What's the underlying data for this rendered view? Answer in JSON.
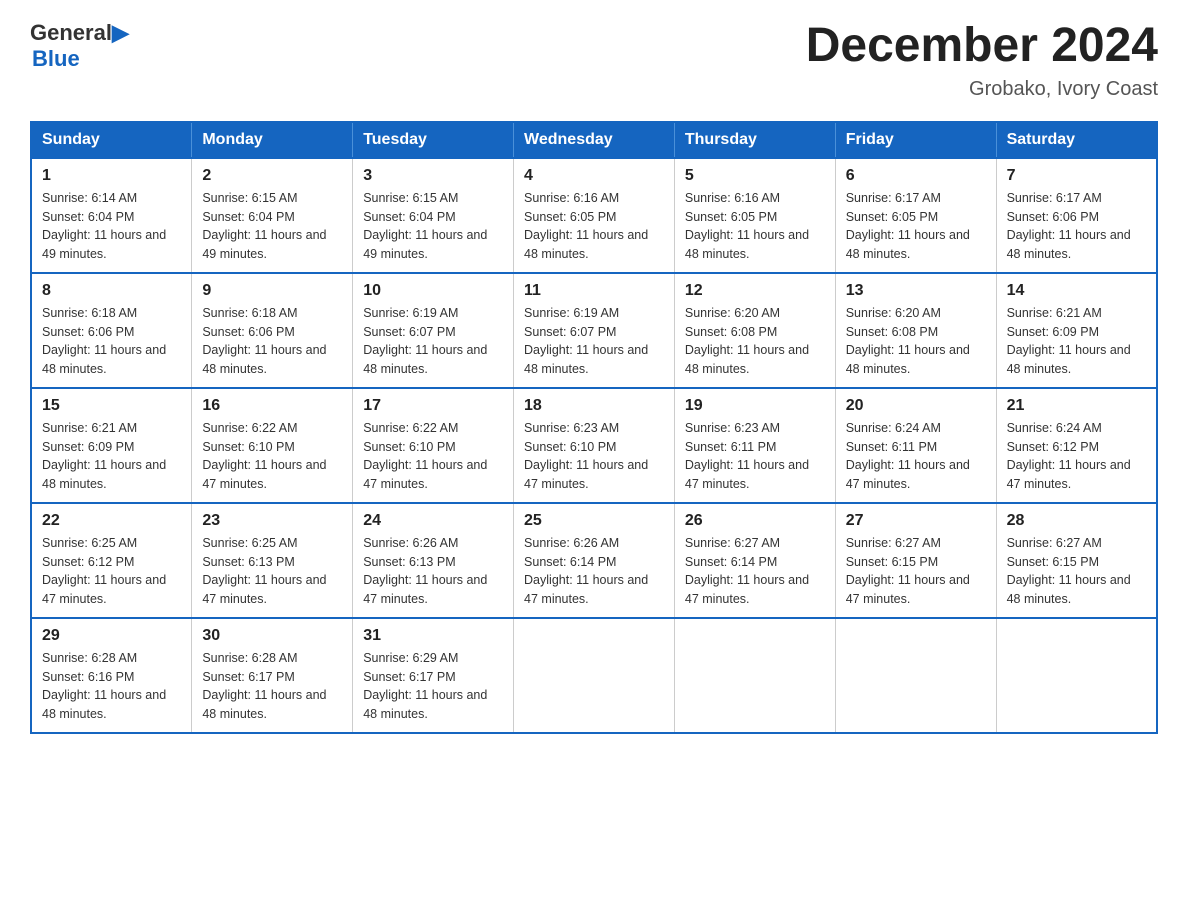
{
  "logo": {
    "general": "General",
    "blue": "Blue",
    "arrow": "▶"
  },
  "title": "December 2024",
  "subtitle": "Grobako, Ivory Coast",
  "days_of_week": [
    "Sunday",
    "Monday",
    "Tuesday",
    "Wednesday",
    "Thursday",
    "Friday",
    "Saturday"
  ],
  "weeks": [
    [
      {
        "day": "1",
        "sunrise": "6:14 AM",
        "sunset": "6:04 PM",
        "daylight": "11 hours and 49 minutes."
      },
      {
        "day": "2",
        "sunrise": "6:15 AM",
        "sunset": "6:04 PM",
        "daylight": "11 hours and 49 minutes."
      },
      {
        "day": "3",
        "sunrise": "6:15 AM",
        "sunset": "6:04 PM",
        "daylight": "11 hours and 49 minutes."
      },
      {
        "day": "4",
        "sunrise": "6:16 AM",
        "sunset": "6:05 PM",
        "daylight": "11 hours and 48 minutes."
      },
      {
        "day": "5",
        "sunrise": "6:16 AM",
        "sunset": "6:05 PM",
        "daylight": "11 hours and 48 minutes."
      },
      {
        "day": "6",
        "sunrise": "6:17 AM",
        "sunset": "6:05 PM",
        "daylight": "11 hours and 48 minutes."
      },
      {
        "day": "7",
        "sunrise": "6:17 AM",
        "sunset": "6:06 PM",
        "daylight": "11 hours and 48 minutes."
      }
    ],
    [
      {
        "day": "8",
        "sunrise": "6:18 AM",
        "sunset": "6:06 PM",
        "daylight": "11 hours and 48 minutes."
      },
      {
        "day": "9",
        "sunrise": "6:18 AM",
        "sunset": "6:06 PM",
        "daylight": "11 hours and 48 minutes."
      },
      {
        "day": "10",
        "sunrise": "6:19 AM",
        "sunset": "6:07 PM",
        "daylight": "11 hours and 48 minutes."
      },
      {
        "day": "11",
        "sunrise": "6:19 AM",
        "sunset": "6:07 PM",
        "daylight": "11 hours and 48 minutes."
      },
      {
        "day": "12",
        "sunrise": "6:20 AM",
        "sunset": "6:08 PM",
        "daylight": "11 hours and 48 minutes."
      },
      {
        "day": "13",
        "sunrise": "6:20 AM",
        "sunset": "6:08 PM",
        "daylight": "11 hours and 48 minutes."
      },
      {
        "day": "14",
        "sunrise": "6:21 AM",
        "sunset": "6:09 PM",
        "daylight": "11 hours and 48 minutes."
      }
    ],
    [
      {
        "day": "15",
        "sunrise": "6:21 AM",
        "sunset": "6:09 PM",
        "daylight": "11 hours and 48 minutes."
      },
      {
        "day": "16",
        "sunrise": "6:22 AM",
        "sunset": "6:10 PM",
        "daylight": "11 hours and 47 minutes."
      },
      {
        "day": "17",
        "sunrise": "6:22 AM",
        "sunset": "6:10 PM",
        "daylight": "11 hours and 47 minutes."
      },
      {
        "day": "18",
        "sunrise": "6:23 AM",
        "sunset": "6:10 PM",
        "daylight": "11 hours and 47 minutes."
      },
      {
        "day": "19",
        "sunrise": "6:23 AM",
        "sunset": "6:11 PM",
        "daylight": "11 hours and 47 minutes."
      },
      {
        "day": "20",
        "sunrise": "6:24 AM",
        "sunset": "6:11 PM",
        "daylight": "11 hours and 47 minutes."
      },
      {
        "day": "21",
        "sunrise": "6:24 AM",
        "sunset": "6:12 PM",
        "daylight": "11 hours and 47 minutes."
      }
    ],
    [
      {
        "day": "22",
        "sunrise": "6:25 AM",
        "sunset": "6:12 PM",
        "daylight": "11 hours and 47 minutes."
      },
      {
        "day": "23",
        "sunrise": "6:25 AM",
        "sunset": "6:13 PM",
        "daylight": "11 hours and 47 minutes."
      },
      {
        "day": "24",
        "sunrise": "6:26 AM",
        "sunset": "6:13 PM",
        "daylight": "11 hours and 47 minutes."
      },
      {
        "day": "25",
        "sunrise": "6:26 AM",
        "sunset": "6:14 PM",
        "daylight": "11 hours and 47 minutes."
      },
      {
        "day": "26",
        "sunrise": "6:27 AM",
        "sunset": "6:14 PM",
        "daylight": "11 hours and 47 minutes."
      },
      {
        "day": "27",
        "sunrise": "6:27 AM",
        "sunset": "6:15 PM",
        "daylight": "11 hours and 47 minutes."
      },
      {
        "day": "28",
        "sunrise": "6:27 AM",
        "sunset": "6:15 PM",
        "daylight": "11 hours and 48 minutes."
      }
    ],
    [
      {
        "day": "29",
        "sunrise": "6:28 AM",
        "sunset": "6:16 PM",
        "daylight": "11 hours and 48 minutes."
      },
      {
        "day": "30",
        "sunrise": "6:28 AM",
        "sunset": "6:17 PM",
        "daylight": "11 hours and 48 minutes."
      },
      {
        "day": "31",
        "sunrise": "6:29 AM",
        "sunset": "6:17 PM",
        "daylight": "11 hours and 48 minutes."
      },
      null,
      null,
      null,
      null
    ]
  ],
  "labels": {
    "sunrise_prefix": "Sunrise: ",
    "sunset_prefix": "Sunset: ",
    "daylight_prefix": "Daylight: "
  }
}
